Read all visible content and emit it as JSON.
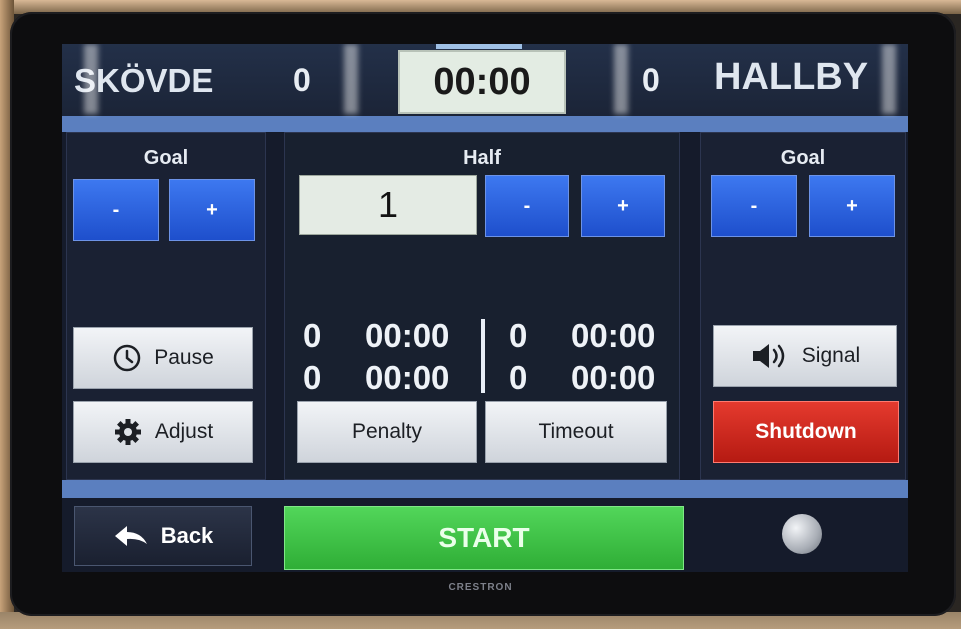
{
  "header": {
    "home_team": "SKÖVDE",
    "home_score": "0",
    "clock": "00:00",
    "away_score": "0",
    "away_team": "HALLBY"
  },
  "left_panel": {
    "title": "Goal",
    "minus_label": "-",
    "plus_label": "+",
    "pause_label": "Pause",
    "adjust_label": "Adjust"
  },
  "middle_panel": {
    "title": "Half",
    "half_value": "1",
    "minus_label": "-",
    "plus_label": "+",
    "penalties_home": [
      {
        "count": "0",
        "time": "00:00"
      },
      {
        "count": "0",
        "time": "00:00"
      }
    ],
    "penalties_away": [
      {
        "count": "0",
        "time": "00:00"
      },
      {
        "count": "0",
        "time": "00:00"
      }
    ],
    "penalty_label": "Penalty",
    "timeout_label": "Timeout"
  },
  "right_panel": {
    "title": "Goal",
    "minus_label": "-",
    "plus_label": "+",
    "signal_label": "Signal",
    "shutdown_label": "Shutdown"
  },
  "footer": {
    "back_label": "Back",
    "start_label": "START"
  },
  "device_brand": "CRESTRON",
  "icons": [
    "clock-icon",
    "gear-icon",
    "speaker-icon",
    "back-arrow-icon"
  ],
  "colors": {
    "blue_button": "#2f63dc",
    "start_green": "#3fc447",
    "shutdown_red": "#d02a20",
    "accent_bar": "#5b7fbf"
  }
}
